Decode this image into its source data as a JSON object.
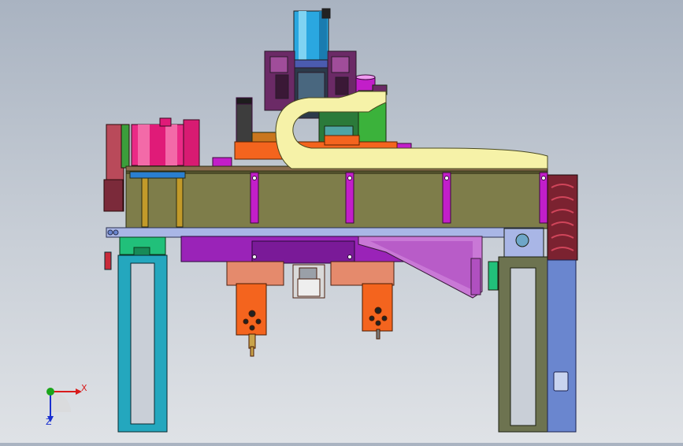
{
  "viewport": {
    "background_top": "#a9b3c1",
    "background_bottom": "#dfe2e6"
  },
  "triad": {
    "x_label": "X",
    "z_label": "Z",
    "x_color": "#d81b1b",
    "y_color": "#1aa51a",
    "z_color": "#1a2fd0"
  },
  "colors": {
    "beam": "#7e7d4a",
    "rail": "#a9b6e6",
    "cable_chain": "#f6f2a8",
    "motor": "#ea2a86",
    "servo": "#2aa7e0",
    "carriage": "#f4641e",
    "pad": "#9a23b8",
    "leg_left": "#24a7be",
    "leg_right": "#6d7350",
    "column_right": "#6a86cf",
    "bracket": "#c978d6",
    "dark_purple": "#6b2a66"
  }
}
